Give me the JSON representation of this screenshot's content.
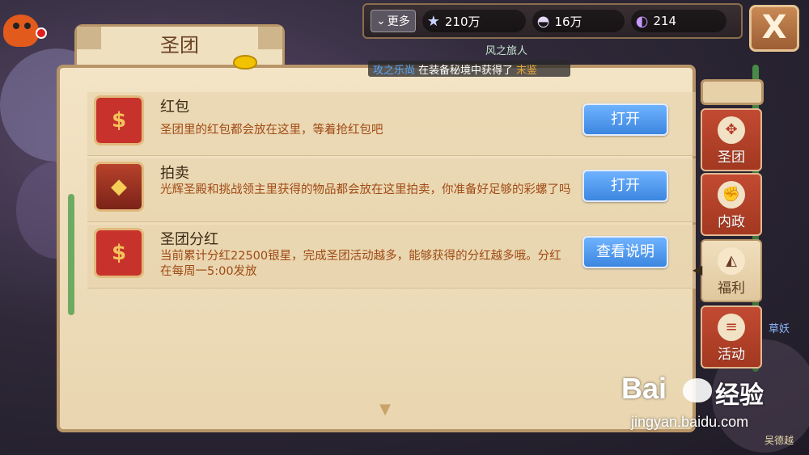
{
  "topbar": {
    "more_label": "更多",
    "resources": [
      {
        "icon": "star-icon",
        "value": "210万"
      },
      {
        "icon": "shell-icon",
        "value": "16万"
      },
      {
        "icon": "crystal-icon",
        "value": "214"
      }
    ]
  },
  "close_label": "X",
  "map_label": "风之旅人",
  "panel": {
    "title": "圣团",
    "ticker": {
      "player": "攻之乐尚",
      "text": "在装备秘境中获得了",
      "item": "末鉴"
    },
    "items": [
      {
        "name": "红包",
        "desc": "圣团里的红包都会放在这里，等着抢红包吧",
        "button": "打开",
        "icon": "red-envelope-icon"
      },
      {
        "name": "拍卖",
        "desc": "光辉圣殿和挑战领主里获得的物品都会放在这里拍卖，你准备好足够的彩螺了吗",
        "button": "打开",
        "icon": "auction-gate-icon"
      },
      {
        "name": "圣团分红",
        "desc": "当前累计分红22500银星，完成圣团活动越多，能够获得的分红越多哦。分红在每周一5:00发放",
        "button": "查看说明",
        "icon": "red-envelope-icon"
      }
    ]
  },
  "side_tabs": [
    {
      "label": "圣团",
      "icon": "emblem-icon",
      "active": false
    },
    {
      "label": "内政",
      "icon": "fist-icon",
      "active": false
    },
    {
      "label": "福利",
      "icon": "cake-icon",
      "active": true
    },
    {
      "label": "活动",
      "icon": "scroll-icon",
      "active": false
    }
  ],
  "right_label": "草妖",
  "footer_label": "吴德越",
  "watermark": {
    "logo": "Bai",
    "logo2": "经验",
    "sub": "jingyan.baidu.com"
  },
  "colors": {
    "accent_blue": "#3c86e0",
    "panel": "#f3e4c6",
    "desc": "#a04a14",
    "tab_red": "#c24a32"
  }
}
